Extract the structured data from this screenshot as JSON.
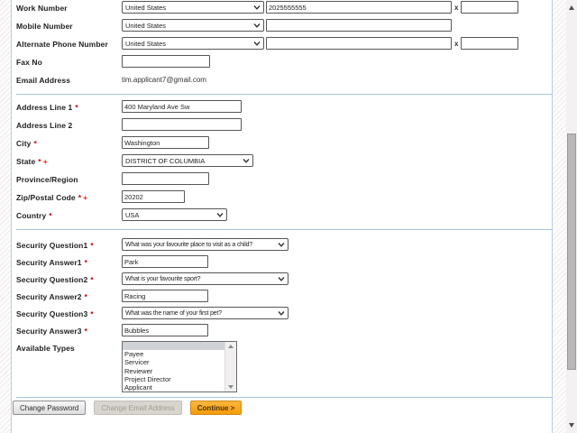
{
  "colors": {
    "accent_orange": "#f9a717",
    "divider_blue": "#a6c5e2",
    "required_asterisk_red": "#cc0000",
    "plus_marker_red": "#ee2200",
    "selected_option_gray": "#cfd2d6"
  },
  "contact": {
    "work": {
      "label": "Work Number",
      "country": "United States",
      "number": "2025555555",
      "ext_label": "x",
      "ext": ""
    },
    "mobile": {
      "label": "Mobile Number",
      "country": "United States",
      "number": ""
    },
    "alternate": {
      "label": "Alternate Phone Number",
      "country": "United States",
      "number": "",
      "ext_label": "x",
      "ext": ""
    },
    "fax": {
      "label": "Fax No",
      "value": ""
    },
    "email": {
      "label": "Email Address",
      "value": "tim.applicant7@gmail.com"
    }
  },
  "address": {
    "line1": {
      "label": "Address Line 1",
      "req": "*",
      "value": "400 Maryland Ave Sw"
    },
    "line2": {
      "label": "Address Line 2",
      "value": ""
    },
    "city": {
      "label": "City",
      "req": "*",
      "value": "Washington"
    },
    "state": {
      "label": "State",
      "req": "*",
      "plus": "+",
      "value": "DISTRICT OF COLUMBIA"
    },
    "province": {
      "label": "Province/Region",
      "value": ""
    },
    "zip": {
      "label": "Zip/Postal Code",
      "req": "*",
      "plus": "+",
      "value": "20202"
    },
    "country": {
      "label": "Country",
      "req": "*",
      "value": "USA"
    }
  },
  "security": {
    "question1": {
      "label": "Security Question1",
      "req": "*",
      "value": "What was your favourite place to visit as a child?"
    },
    "answer1": {
      "label": "Security Answer1",
      "req": "*",
      "value": "Park"
    },
    "question2": {
      "label": "Security Question2",
      "req": "*",
      "value": "What is your favourite sport?"
    },
    "answer2": {
      "label": "Security Answer2",
      "req": "*",
      "value": "Racing"
    },
    "question3": {
      "label": "Security Question3",
      "req": "*",
      "value": "What was the name of your first pet?"
    },
    "answer3": {
      "label": "Security Answer3",
      "req": "*",
      "value": "Bubbles"
    }
  },
  "available_types": {
    "label": "Available Types",
    "options": [
      "",
      "Payee",
      "Servicer",
      "Reviewer",
      "Project Director",
      "Applicant"
    ],
    "selected_index": 0
  },
  "buttons": {
    "change_password": "Change Password",
    "change_email_address": "Change Email Address",
    "continue": "Continue >"
  }
}
